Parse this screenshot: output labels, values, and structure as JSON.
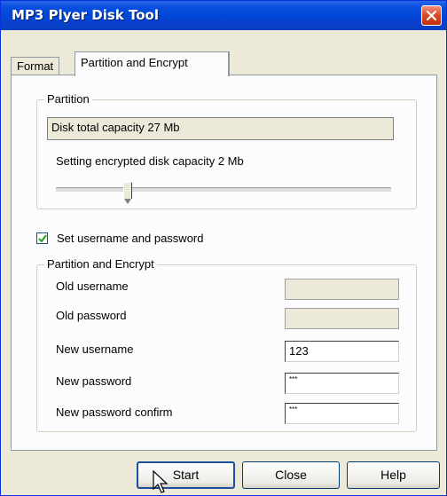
{
  "window": {
    "title": "MP3 Plyer Disk Tool"
  },
  "tabs": [
    {
      "label": "Format"
    },
    {
      "label": "Partition and Encrypt"
    }
  ],
  "partition": {
    "group_label": "Partition",
    "total_capacity": "Disk total capacity 27 Mb",
    "encrypted_capacity": "Setting encrypted disk capacity 2 Mb",
    "slider_fraction": 0.2
  },
  "credentials": {
    "checkbox_label": "Set username and password",
    "checked": true,
    "group_label": "Partition and Encrypt",
    "old_username_label": "Old username",
    "old_password_label": "Old password",
    "new_username_label": "New username",
    "new_password_label": "New password",
    "new_password_confirm_label": "New password confirm",
    "old_username_value": "",
    "old_password_value": "",
    "new_username_value": "123",
    "new_password_value": "***",
    "new_password_confirm_value": "***"
  },
  "buttons": {
    "start": "Start",
    "close": "Close",
    "help": "Help"
  }
}
